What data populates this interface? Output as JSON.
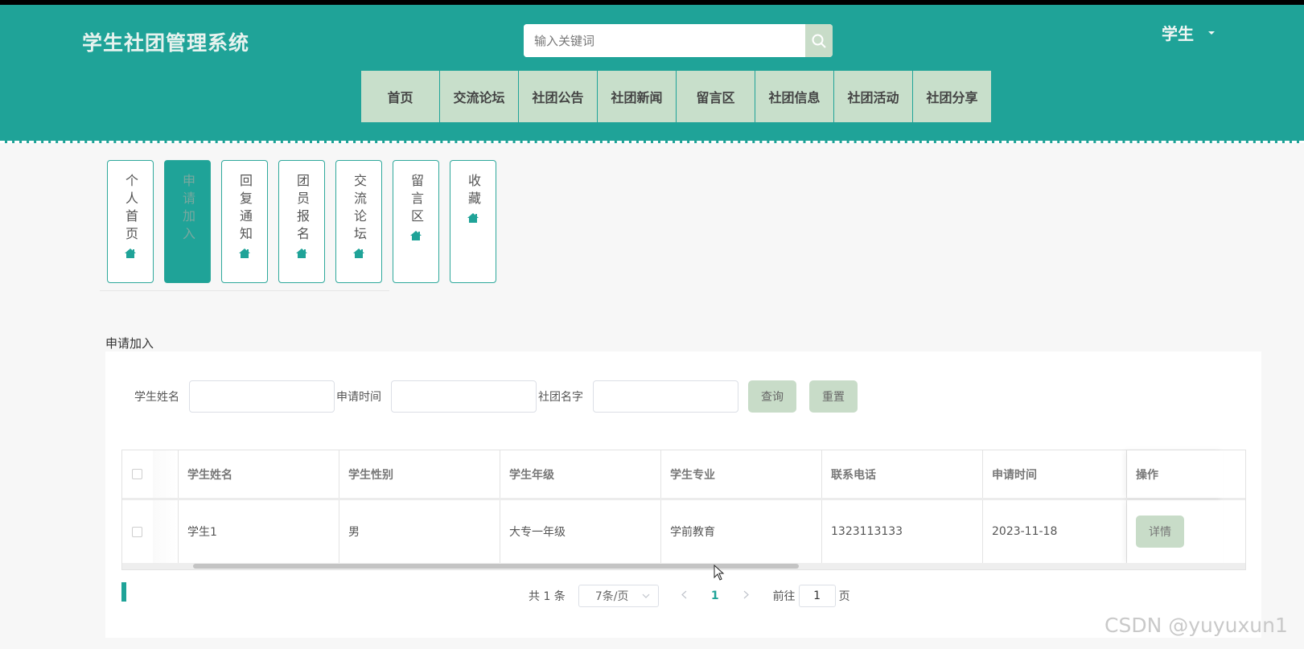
{
  "header": {
    "brand": "学生社团管理系统",
    "search_placeholder": "输入关键词",
    "user_label": "学生",
    "nav": [
      "首页",
      "交流论坛",
      "社团公告",
      "社团新闻",
      "留言区",
      "社团信息",
      "社团活动",
      "社团分享"
    ]
  },
  "sidebar": {
    "items": [
      {
        "label": "个人首页",
        "active": false
      },
      {
        "label": "申请加入",
        "active": true
      },
      {
        "label": "回复通知",
        "active": false
      },
      {
        "label": "团员报名",
        "active": false
      },
      {
        "label": "交流论坛",
        "active": false
      },
      {
        "label": "留言区",
        "active": false
      },
      {
        "label": "收藏",
        "active": false
      }
    ]
  },
  "page": {
    "title": "申请加入",
    "filters": {
      "student_name_label": "学生姓名",
      "apply_time_label": "申请时间",
      "club_name_label": "社团名字",
      "query_button": "查询",
      "reset_button": "重置"
    },
    "table": {
      "columns": [
        "学生姓名",
        "学生性别",
        "学生年级",
        "学生专业",
        "联系电话",
        "申请时间",
        "操作"
      ],
      "rows": [
        {
          "name": "学生1",
          "gender": "男",
          "grade": "大专一年级",
          "major": "学前教育",
          "phone": "1323113133",
          "time": "2023-11-18",
          "action": "详情"
        }
      ]
    },
    "pagination": {
      "total_text": "共 1 条",
      "page_size": "7条/页",
      "current_page": "1",
      "goto_label": "前往",
      "goto_value": "1",
      "page_suffix": "页"
    }
  },
  "watermark": "CSDN @yuyuxun1",
  "colors": {
    "primary": "#1fa398",
    "button": "#c8dcc8"
  }
}
